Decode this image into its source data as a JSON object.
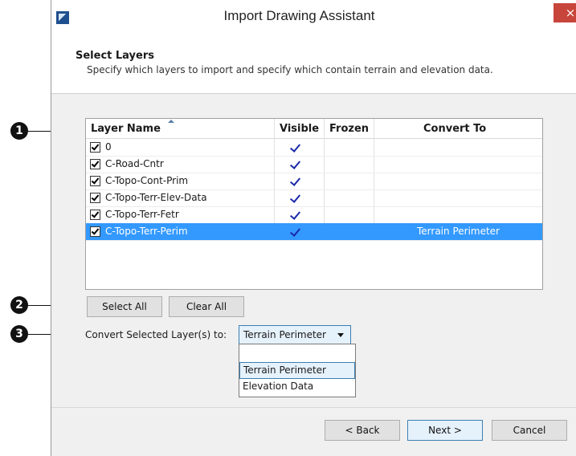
{
  "window": {
    "title": "Import Drawing Assistant",
    "close_label": "×"
  },
  "header": {
    "title": "Select Layers",
    "description": "Specify which layers to import and specify which contain terrain and elevation data."
  },
  "layer_table": {
    "columns": [
      "Layer Name",
      "Visible",
      "Frozen",
      "Convert To"
    ],
    "rows": [
      {
        "name": "0",
        "checked": true,
        "visible": true,
        "frozen": false,
        "convert_to": ""
      },
      {
        "name": "C-Road-Cntr",
        "checked": true,
        "visible": true,
        "frozen": false,
        "convert_to": ""
      },
      {
        "name": "C-Topo-Cont-Prim",
        "checked": true,
        "visible": true,
        "frozen": false,
        "convert_to": ""
      },
      {
        "name": "C-Topo-Terr-Elev-Data",
        "checked": true,
        "visible": true,
        "frozen": false,
        "convert_to": ""
      },
      {
        "name": "C-Topo-Terr-Fetr",
        "checked": true,
        "visible": true,
        "frozen": false,
        "convert_to": ""
      },
      {
        "name": "C-Topo-Terr-Perim",
        "checked": true,
        "visible": true,
        "frozen": false,
        "convert_to": "Terrain Perimeter",
        "selected": true
      }
    ]
  },
  "buttons": {
    "select_all": "Select All",
    "clear_all": "Clear All",
    "back": "< Back",
    "next": "Next >",
    "cancel": "Cancel"
  },
  "convert": {
    "label": "Convert Selected Layer(s) to:",
    "selected_value": "Terrain Perimeter",
    "options": [
      "",
      "Terrain Perimeter",
      "Elevation Data"
    ]
  },
  "callouts": [
    "1",
    "2",
    "3"
  ],
  "colors": {
    "selection": "#3399ff",
    "close_button": "#c7453a",
    "callout": "#111111"
  }
}
